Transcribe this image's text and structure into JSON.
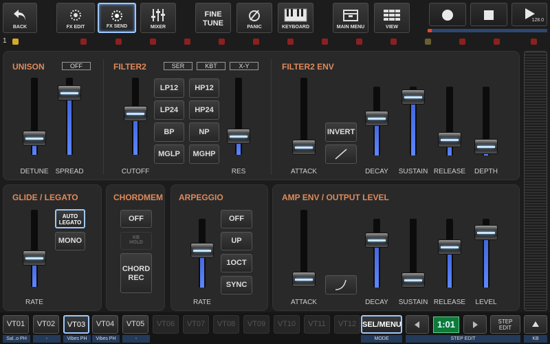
{
  "toolbar": {
    "back": "BACK",
    "fx_edit": "FX EDIT",
    "fx_send": "FX SEND",
    "mixer": "MIXER",
    "fine_tune_1": "FINE",
    "fine_tune_2": "TUNE",
    "panic": "PANIC",
    "keyboard": "KEYBOARD",
    "main_menu": "MAIN MENU",
    "view": "VIEW",
    "tempo": "128.0",
    "pattern_num": "1"
  },
  "unison": {
    "title": "UNISON",
    "mode": "OFF",
    "detune": "DETUNE",
    "spread": "SPREAD",
    "detune_level": 0.15,
    "spread_level": 0.88
  },
  "filter2": {
    "title": "FILTER2",
    "ser": "SER",
    "kbt": "KBT",
    "xy": "X-Y",
    "types": [
      "LP12",
      "HP12",
      "LP24",
      "HP24",
      "BP",
      "NP",
      "MGLP",
      "MGHP"
    ],
    "cutoff": "CUTOFF",
    "res": "RES",
    "cutoff_level": 0.55,
    "res_level": 0.18
  },
  "filter2_env": {
    "title": "FILTER2 ENV",
    "invert": "INVERT",
    "attack": "ATTACK",
    "decay": "DECAY",
    "sustain": "SUSTAIN",
    "release": "RELEASE",
    "depth": "DEPTH",
    "attack_level": 0.0,
    "decay_level": 0.55,
    "sustain_level": 0.95,
    "release_level": 0.15,
    "depth_level": 0.02
  },
  "glide": {
    "title": "GLIDE / LEGATO",
    "auto_1": "AUTO",
    "auto_2": "LEGATO",
    "mono": "MONO",
    "rate": "RATE",
    "rate_level": 0.35
  },
  "chordmem": {
    "title": "CHORDMEM",
    "off": "OFF",
    "kb_1": "KB",
    "kb_2": "HOLD",
    "chord_1": "CHORD",
    "chord_2": "REC"
  },
  "arpeggio": {
    "title": "ARPEGGIO",
    "off": "OFF",
    "up": "UP",
    "oct": "1OCT",
    "sync": "SYNC",
    "rate": "RATE",
    "rate_level": 0.55
  },
  "amp_env": {
    "title": "AMP ENV / OUTPUT LEVEL",
    "attack": "ATTACK",
    "decay": "DECAY",
    "sustain": "SUSTAIN",
    "release": "RELEASE",
    "level": "LEVEL",
    "attack_level": 0.0,
    "decay_level": 0.75,
    "sustain_level": 0.0,
    "release_level": 0.62,
    "level_level": 0.88
  },
  "tracks": [
    {
      "name": "VT01",
      "sub": "Sal..o PH"
    },
    {
      "name": "VT02",
      "sub": "-"
    },
    {
      "name": "VT03",
      "sub": "Vibes PH"
    },
    {
      "name": "VT04",
      "sub": "Vibes PH"
    },
    {
      "name": "VT05",
      "sub": "-"
    },
    {
      "name": "VT06",
      "sub": ""
    },
    {
      "name": "VT07",
      "sub": ""
    },
    {
      "name": "VT08",
      "sub": ""
    },
    {
      "name": "VT09",
      "sub": ""
    },
    {
      "name": "VT10",
      "sub": ""
    },
    {
      "name": "VT11",
      "sub": ""
    },
    {
      "name": "VT12",
      "sub": ""
    }
  ],
  "bottom": {
    "sel_menu": "SEL/MENU",
    "mode": "MODE",
    "position": "1:01",
    "step_edit_1": "STEP",
    "step_edit_2": "EDIT",
    "step_edit_label": "STEP EDIT",
    "kb": "KB"
  }
}
